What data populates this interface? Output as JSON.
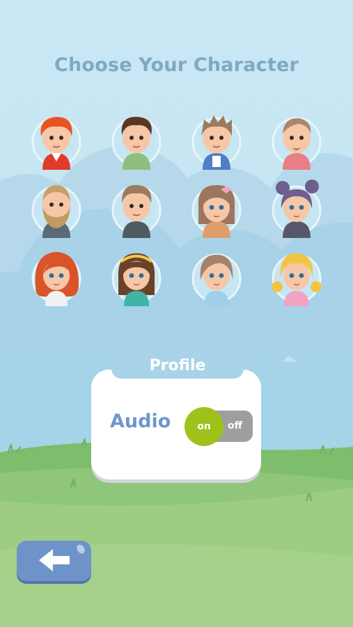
{
  "screen": {
    "title": "Choose Your Character"
  },
  "characters": [
    {
      "name": "boy-red-hair"
    },
    {
      "name": "boy-brown-hair"
    },
    {
      "name": "boy-spiky-hair"
    },
    {
      "name": "man-goatee"
    },
    {
      "name": "man-beard"
    },
    {
      "name": "man-brown-hair"
    },
    {
      "name": "girl-bow"
    },
    {
      "name": "girl-purple-buns"
    },
    {
      "name": "woman-red-hair"
    },
    {
      "name": "girl-headband"
    },
    {
      "name": "girl-short-hair"
    },
    {
      "name": "girl-blonde-pigtails"
    }
  ],
  "profile": {
    "tab_label": "Profile",
    "audio_label": "Audio",
    "audio_on_label": "on",
    "audio_off_label": "off",
    "audio_enabled": true
  },
  "back_button": {
    "icon": "arrow-left-icon"
  },
  "colors": {
    "sky": "#c9e7f3",
    "title": "#7fa9c3",
    "tab": "#a9d3e9",
    "audio_text": "#6f96cf",
    "toggle_on": "#9fc21a",
    "toggle_off": "#9e9ea0",
    "back_button": "#6e93c9",
    "grass": "#8fc679"
  }
}
